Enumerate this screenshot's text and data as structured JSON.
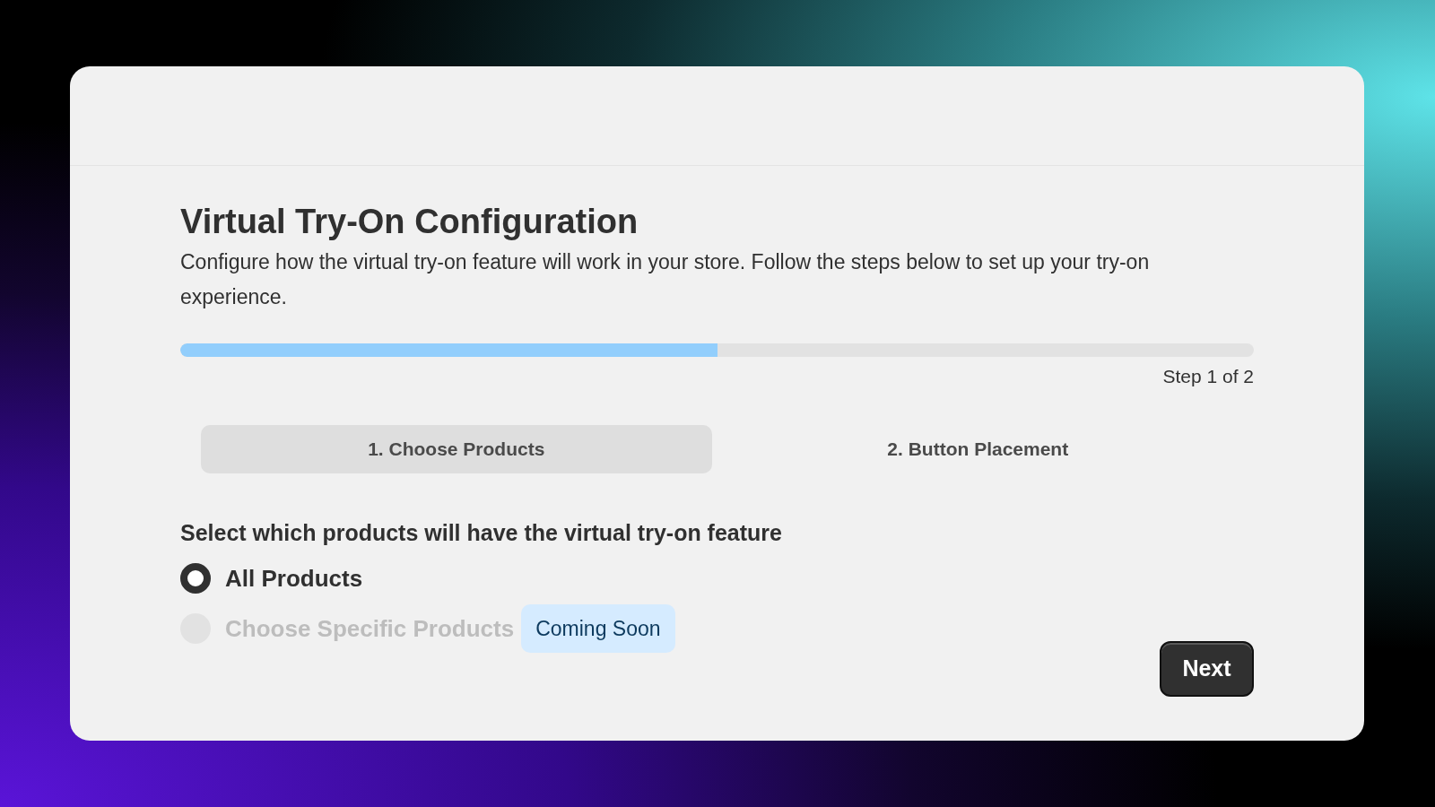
{
  "title": "Virtual Try-On Configuration",
  "description": "Configure how the virtual try-on feature will work in your store. Follow the steps below to set up your try-on experience.",
  "progress": {
    "level": 0.5,
    "label": "Step 1 of 2"
  },
  "tabs": [
    {
      "label": "1. Choose Products",
      "selected": true
    },
    {
      "label": "2. Button Placement",
      "selected": false
    }
  ],
  "question": "Select which products will have the virtual try-on feature",
  "options": [
    {
      "label": "All Products",
      "selected": true,
      "disabled": false
    },
    {
      "label": "Choose Specific Products",
      "selected": false,
      "disabled": true,
      "badge": "Coming Soon"
    }
  ],
  "next_button": "Next"
}
